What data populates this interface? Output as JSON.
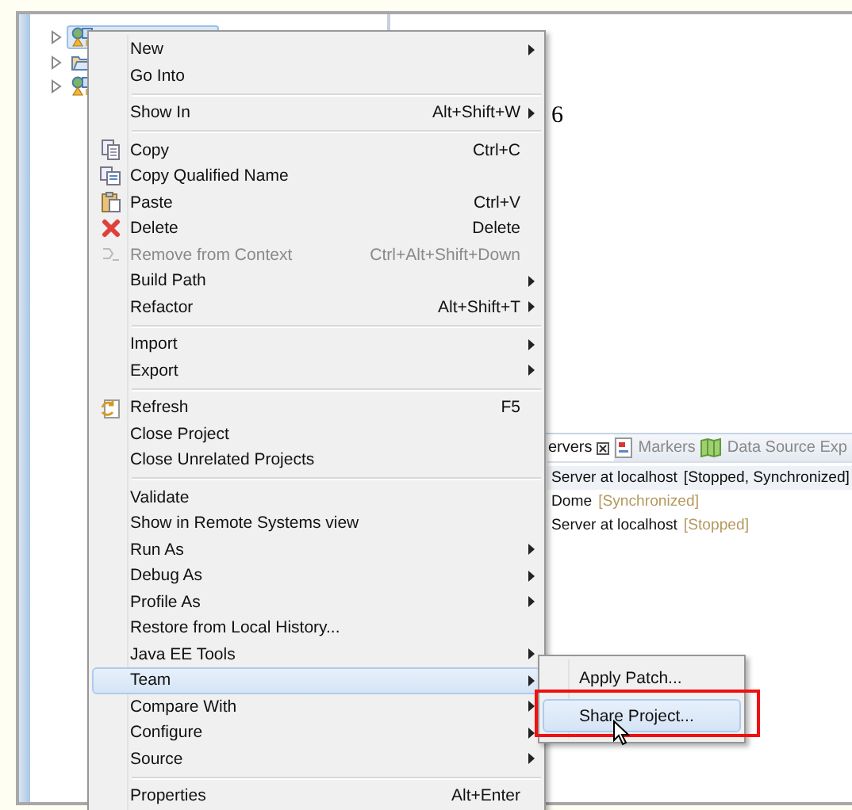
{
  "project_tree": {
    "items": [
      {
        "selected": true,
        "expanded": false
      },
      {
        "selected": false,
        "expanded": false
      },
      {
        "selected": false,
        "expanded": false
      }
    ]
  },
  "editor": {
    "text": "6"
  },
  "servers_view": {
    "tabs": [
      {
        "label": "ervers",
        "closable": true,
        "selected": true
      },
      {
        "label": "Markers",
        "closable": false,
        "selected": false
      },
      {
        "label": "Data Source Exp",
        "closable": false,
        "selected": false
      }
    ],
    "rows": [
      {
        "name": "Server at localhost",
        "status": "[Stopped, Synchronized]",
        "selected": true
      },
      {
        "name": "Dome",
        "status": "[Synchronized]",
        "selected": false
      },
      {
        "name": "Server at localhost",
        "status": "[Stopped]",
        "selected": false
      }
    ]
  },
  "context_menu": {
    "items": [
      {
        "kind": "item",
        "label": "New",
        "submenu": true,
        "disabled": false,
        "selected": false
      },
      {
        "kind": "item",
        "label": "Go Into",
        "submenu": false,
        "disabled": false,
        "selected": false
      },
      {
        "kind": "separator"
      },
      {
        "kind": "item",
        "label": "Show In",
        "shortcut": "Alt+Shift+W",
        "submenu": true,
        "disabled": false,
        "selected": false
      },
      {
        "kind": "separator"
      },
      {
        "kind": "item",
        "label": "Copy",
        "shortcut": "Ctrl+C",
        "submenu": false,
        "disabled": false,
        "selected": false
      },
      {
        "kind": "item",
        "label": "Copy Qualified Name",
        "submenu": false,
        "disabled": false,
        "selected": false
      },
      {
        "kind": "item",
        "label": "Paste",
        "shortcut": "Ctrl+V",
        "submenu": false,
        "disabled": false,
        "selected": false
      },
      {
        "kind": "item",
        "label": "Delete",
        "shortcut": "Delete",
        "submenu": false,
        "disabled": false,
        "selected": false
      },
      {
        "kind": "item",
        "label": "Remove from Context",
        "shortcut": "Ctrl+Alt+Shift+Down",
        "submenu": false,
        "disabled": true,
        "selected": false
      },
      {
        "kind": "item",
        "label": "Build Path",
        "submenu": true,
        "disabled": false,
        "selected": false
      },
      {
        "kind": "item",
        "label": "Refactor",
        "shortcut": "Alt+Shift+T",
        "submenu": true,
        "disabled": false,
        "selected": false
      },
      {
        "kind": "separator"
      },
      {
        "kind": "item",
        "label": "Import",
        "submenu": true,
        "disabled": false,
        "selected": false
      },
      {
        "kind": "item",
        "label": "Export",
        "submenu": true,
        "disabled": false,
        "selected": false
      },
      {
        "kind": "separator"
      },
      {
        "kind": "item",
        "label": "Refresh",
        "shortcut": "F5",
        "submenu": false,
        "disabled": false,
        "selected": false
      },
      {
        "kind": "item",
        "label": "Close Project",
        "submenu": false,
        "disabled": false,
        "selected": false
      },
      {
        "kind": "item",
        "label": "Close Unrelated Projects",
        "submenu": false,
        "disabled": false,
        "selected": false
      },
      {
        "kind": "separator"
      },
      {
        "kind": "item",
        "label": "Validate",
        "submenu": false,
        "disabled": false,
        "selected": false
      },
      {
        "kind": "item",
        "label": "Show in Remote Systems view",
        "submenu": false,
        "disabled": false,
        "selected": false
      },
      {
        "kind": "item",
        "label": "Run As",
        "submenu": true,
        "disabled": false,
        "selected": false
      },
      {
        "kind": "item",
        "label": "Debug As",
        "submenu": true,
        "disabled": false,
        "selected": false
      },
      {
        "kind": "item",
        "label": "Profile As",
        "submenu": true,
        "disabled": false,
        "selected": false
      },
      {
        "kind": "item",
        "label": "Restore from Local History...",
        "submenu": false,
        "disabled": false,
        "selected": false
      },
      {
        "kind": "item",
        "label": "Java EE Tools",
        "submenu": true,
        "disabled": false,
        "selected": false
      },
      {
        "kind": "item",
        "label": "Team",
        "submenu": true,
        "disabled": false,
        "selected": true
      },
      {
        "kind": "item",
        "label": "Compare With",
        "submenu": true,
        "disabled": false,
        "selected": false
      },
      {
        "kind": "item",
        "label": "Configure",
        "submenu": true,
        "disabled": false,
        "selected": false
      },
      {
        "kind": "item",
        "label": "Source",
        "submenu": true,
        "disabled": false,
        "selected": false
      },
      {
        "kind": "separator"
      },
      {
        "kind": "item",
        "label": "Properties",
        "shortcut": "Alt+Enter",
        "submenu": false,
        "disabled": false,
        "selected": false
      }
    ]
  },
  "team_submenu": {
    "items": [
      {
        "label": "Apply Patch...",
        "selected": false,
        "highlighted": false
      },
      {
        "label": "Share Project...",
        "selected": true,
        "highlighted": true
      }
    ]
  }
}
